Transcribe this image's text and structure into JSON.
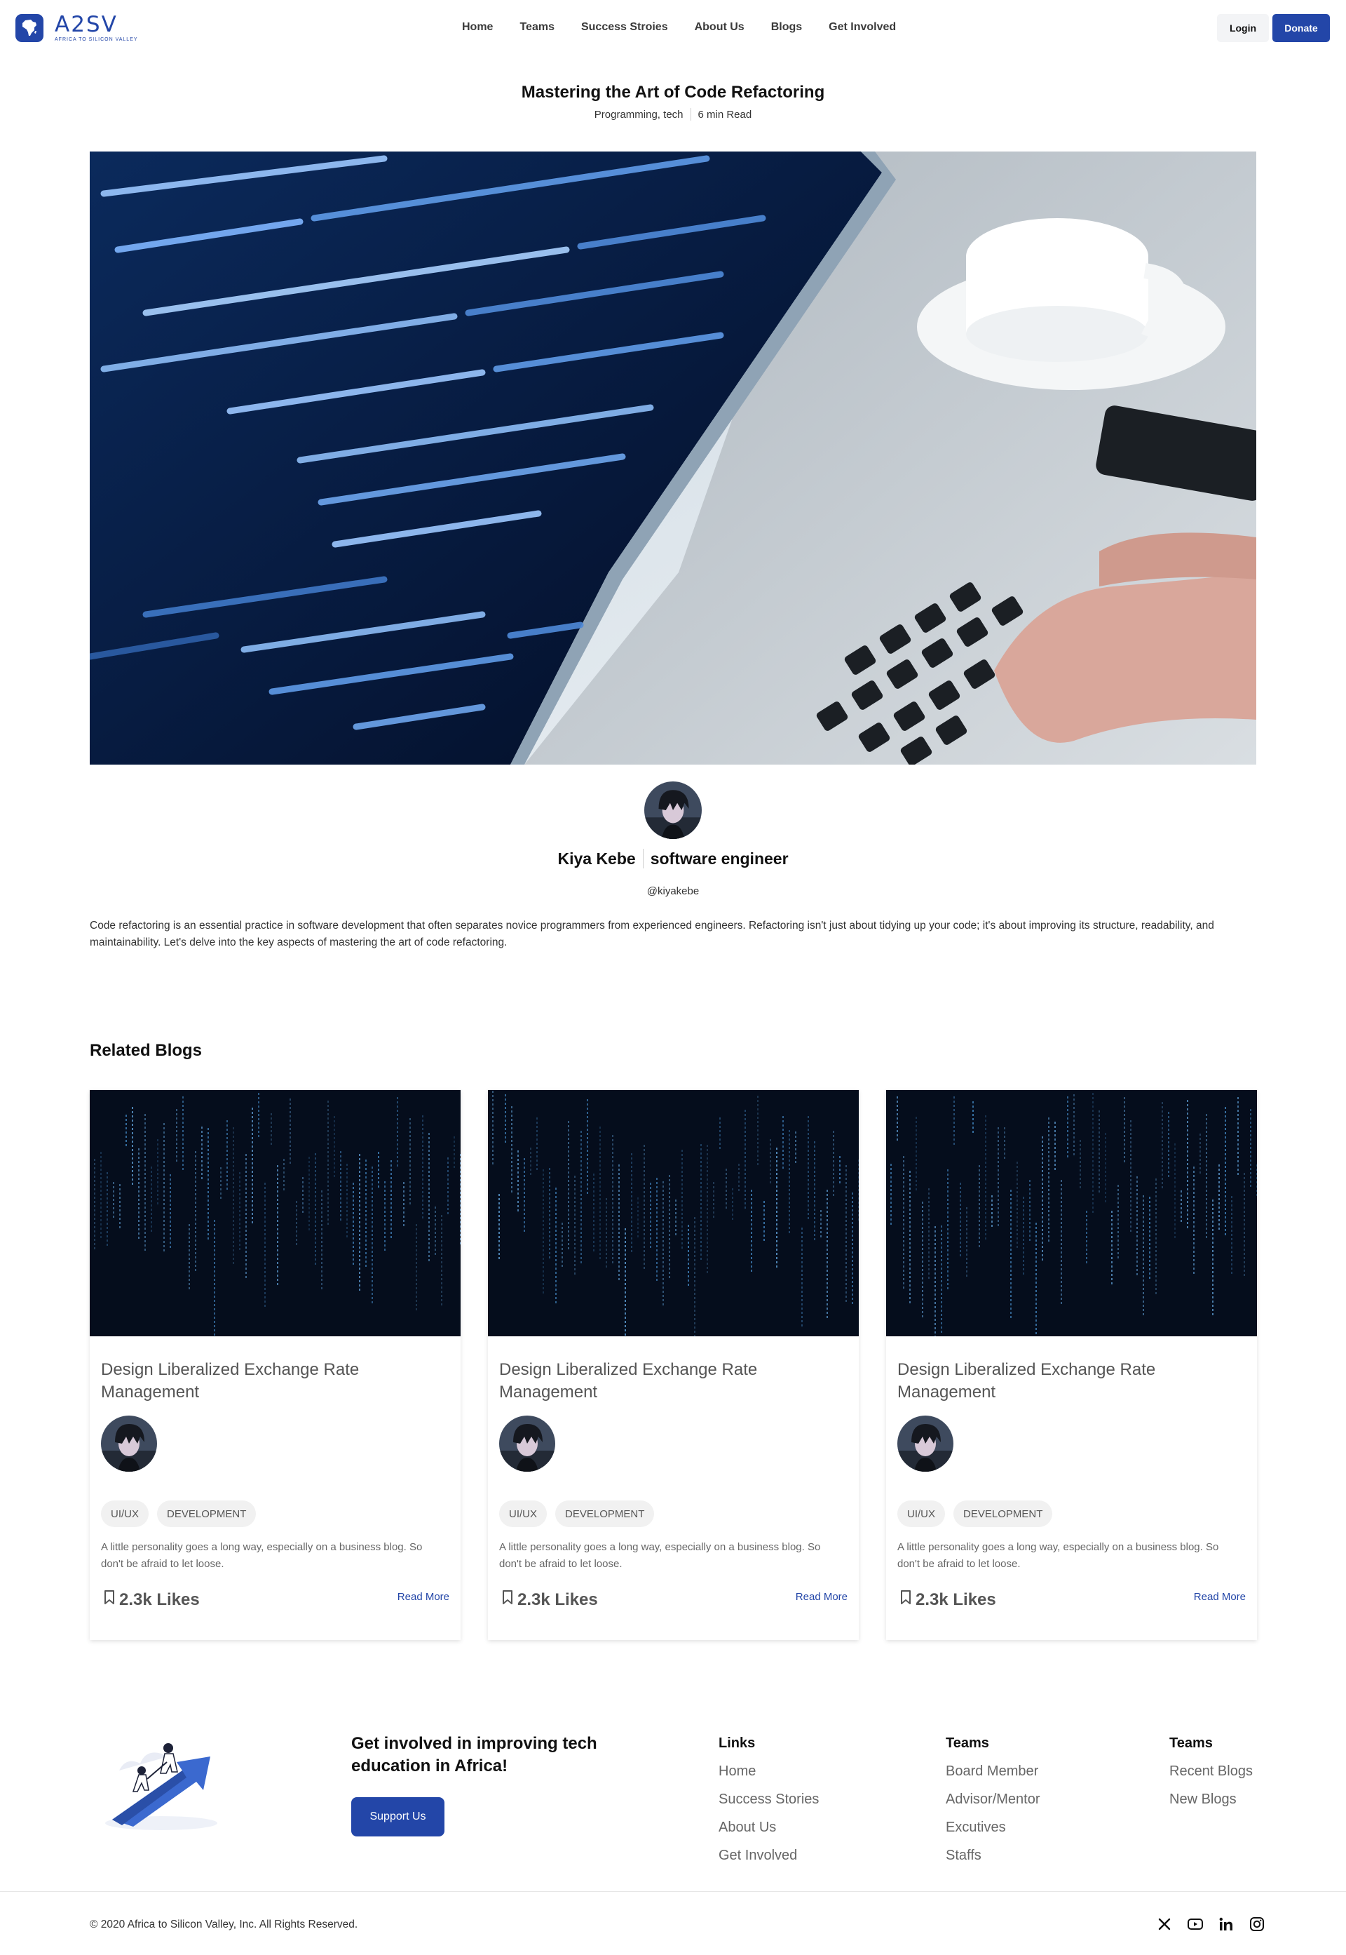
{
  "header": {
    "logo_word": "A2SV",
    "logo_tagline": "AFRICA TO SILICON VALLEY",
    "nav": [
      "Home",
      "Teams",
      "Success Stroies",
      "About Us",
      "Blogs",
      "Get Involved"
    ],
    "login": "Login",
    "donate": "Donate"
  },
  "article": {
    "title": "Mastering the Art of Code Refactoring",
    "categories": "Programming, tech",
    "read_time": "6 min Read",
    "author_name": "Kiya Kebe",
    "author_role": "software engineer",
    "author_handle": "@kiyakebe",
    "intro": "Code refactoring is an essential practice in software development that often separates novice programmers from experienced engineers. Refactoring isn't just about tidying up your code; it's about improving its structure, readability, and maintainability. Let's delve into the key aspects of mastering the art of code refactoring."
  },
  "related": {
    "heading": "Related Blogs",
    "cards": [
      {
        "title": "Design Liberalized Exchange Rate Management",
        "tags": [
          "UI/UX",
          "DEVELOPMENT"
        ],
        "desc": "A little personality goes a long way, especially on a business blog. So don't be afraid to let loose.",
        "likes": "2.3k Likes",
        "read_more": "Read More"
      },
      {
        "title": "Design Liberalized Exchange Rate Management",
        "tags": [
          "UI/UX",
          "DEVELOPMENT"
        ],
        "desc": "A little personality goes a long way, especially on a business blog. So don't be afraid to let loose.",
        "likes": "2.3k Likes",
        "read_more": "Read More"
      },
      {
        "title": "Design Liberalized Exchange Rate Management",
        "tags": [
          "UI/UX",
          "DEVELOPMENT"
        ],
        "desc": "A little personality goes a long way, especially on a business blog. So don't be afraid to let loose.",
        "likes": "2.3k Likes",
        "read_more": "Read More"
      }
    ]
  },
  "footer": {
    "cta": "Get involved in improving tech education in Africa!",
    "support": "Support Us",
    "columns": [
      {
        "heading": "Links",
        "items": [
          "Home",
          "Success Stories",
          "About Us",
          "Get Involved"
        ]
      },
      {
        "heading": "Teams",
        "items": [
          "Board Member",
          "Advisor/Mentor",
          "Excutives",
          "Staffs"
        ]
      },
      {
        "heading": "Teams",
        "items": [
          "Recent Blogs",
          "New Blogs"
        ]
      }
    ],
    "copyright": "© 2020 Africa to Silicon Valley, Inc. All Rights Reserved.",
    "socials": [
      "x-icon",
      "youtube-icon",
      "linkedin-icon",
      "instagram-icon"
    ]
  },
  "colors": {
    "brand": "#2346a8",
    "text": "#111111",
    "muted": "#666666"
  }
}
